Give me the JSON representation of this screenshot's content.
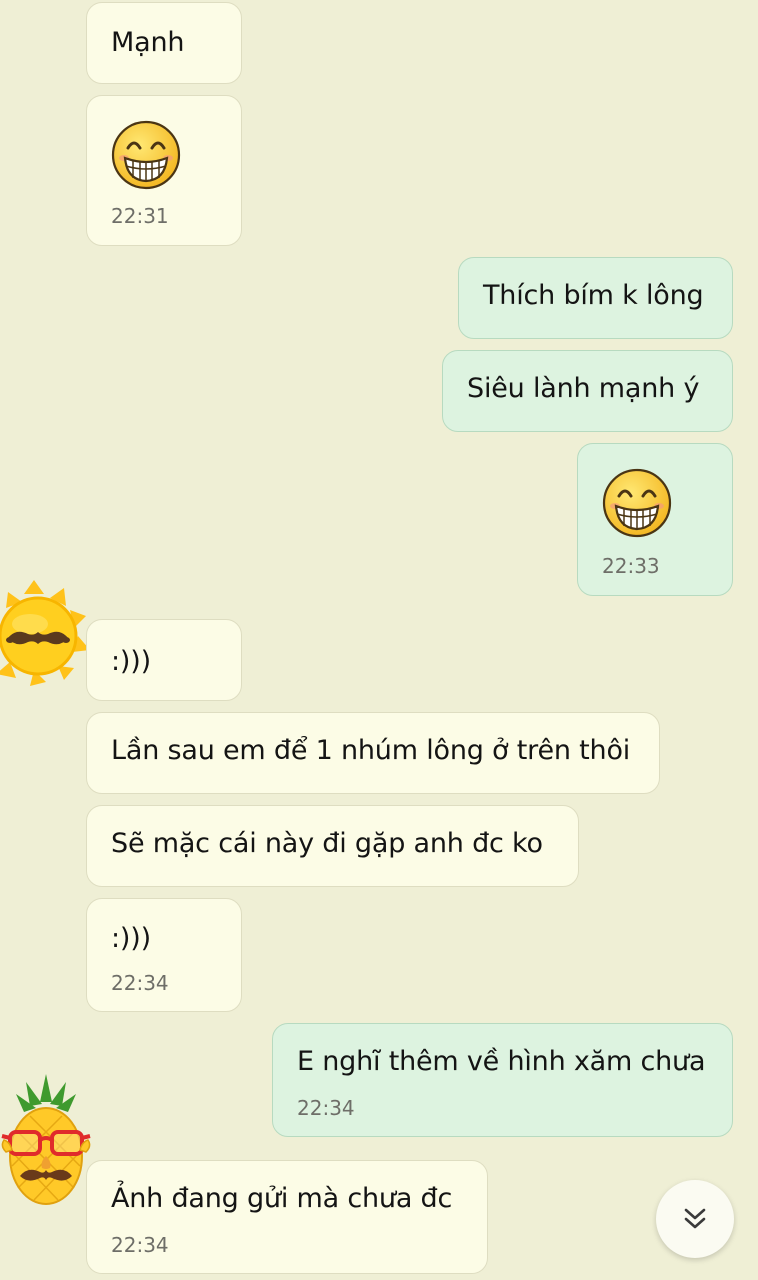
{
  "messages": [
    {
      "text": "Mạnh"
    },
    {
      "emoji": "grinning-face-emoji",
      "time": "22:31"
    },
    {
      "text": "Thích bím k lông"
    },
    {
      "text": "Siêu lành mạnh ý"
    },
    {
      "emoji": "grinning-face-emoji",
      "time": "22:33"
    },
    {
      "text": ":)))"
    },
    {
      "text": "Lần sau em để 1 nhúm lông ở trên thôi"
    },
    {
      "text": "Sẽ mặc cái này đi gặp anh đc ko"
    },
    {
      "text": ":)))",
      "time": "22:34"
    },
    {
      "text": "E nghĩ thêm về hình xăm chưa",
      "time": "22:34"
    },
    {
      "text": "Ảnh đang gửi mà chưa đc",
      "time": "22:34"
    }
  ],
  "avatars": [
    {
      "icon": "sun-mustache-avatar"
    },
    {
      "icon": "pineapple-glasses-avatar"
    }
  ],
  "scroll_button": {
    "icon": "double-chevron-down-icon"
  },
  "colors": {
    "background": "#efefd5",
    "incoming_bubble": "#fcfce6",
    "outgoing_bubble": "#ddf3e0",
    "timestamp": "#6e6e68"
  }
}
